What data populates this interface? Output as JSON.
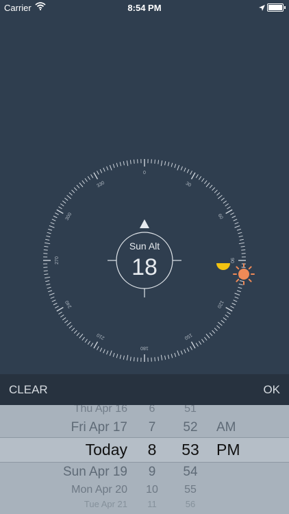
{
  "status_bar": {
    "carrier": "Carrier",
    "time": "8:54 PM"
  },
  "dial": {
    "center_label": "Sun Alt",
    "center_value": "18",
    "heading_labels": [
      "0",
      "30",
      "60",
      "90",
      "120",
      "150",
      "180",
      "210",
      "240",
      "270",
      "300",
      "330"
    ],
    "sun_icon": "sun-icon",
    "moon_icon": "moon-icon"
  },
  "toolbar": {
    "clear_label": "CLEAR",
    "ok_label": "OK"
  },
  "picker": {
    "dates": [
      "Thu Apr 16",
      "Fri Apr 17",
      "Today",
      "Sun Apr 19",
      "Mon Apr 20",
      "Tue Apr 21"
    ],
    "hours": [
      "6",
      "7",
      "8",
      "9",
      "10",
      "11"
    ],
    "minutes": [
      "51",
      "52",
      "53",
      "54",
      "55",
      "56"
    ],
    "ampm": [
      "AM",
      "PM"
    ],
    "selected": {
      "date": "Today",
      "hour": "8",
      "minute": "53",
      "ampm": "PM"
    }
  },
  "colors": {
    "background": "#2f3e4f",
    "toolbar": "#27323f",
    "picker": "#a8b2bc",
    "sun": "#f08a57",
    "moon": "#f2c311"
  }
}
